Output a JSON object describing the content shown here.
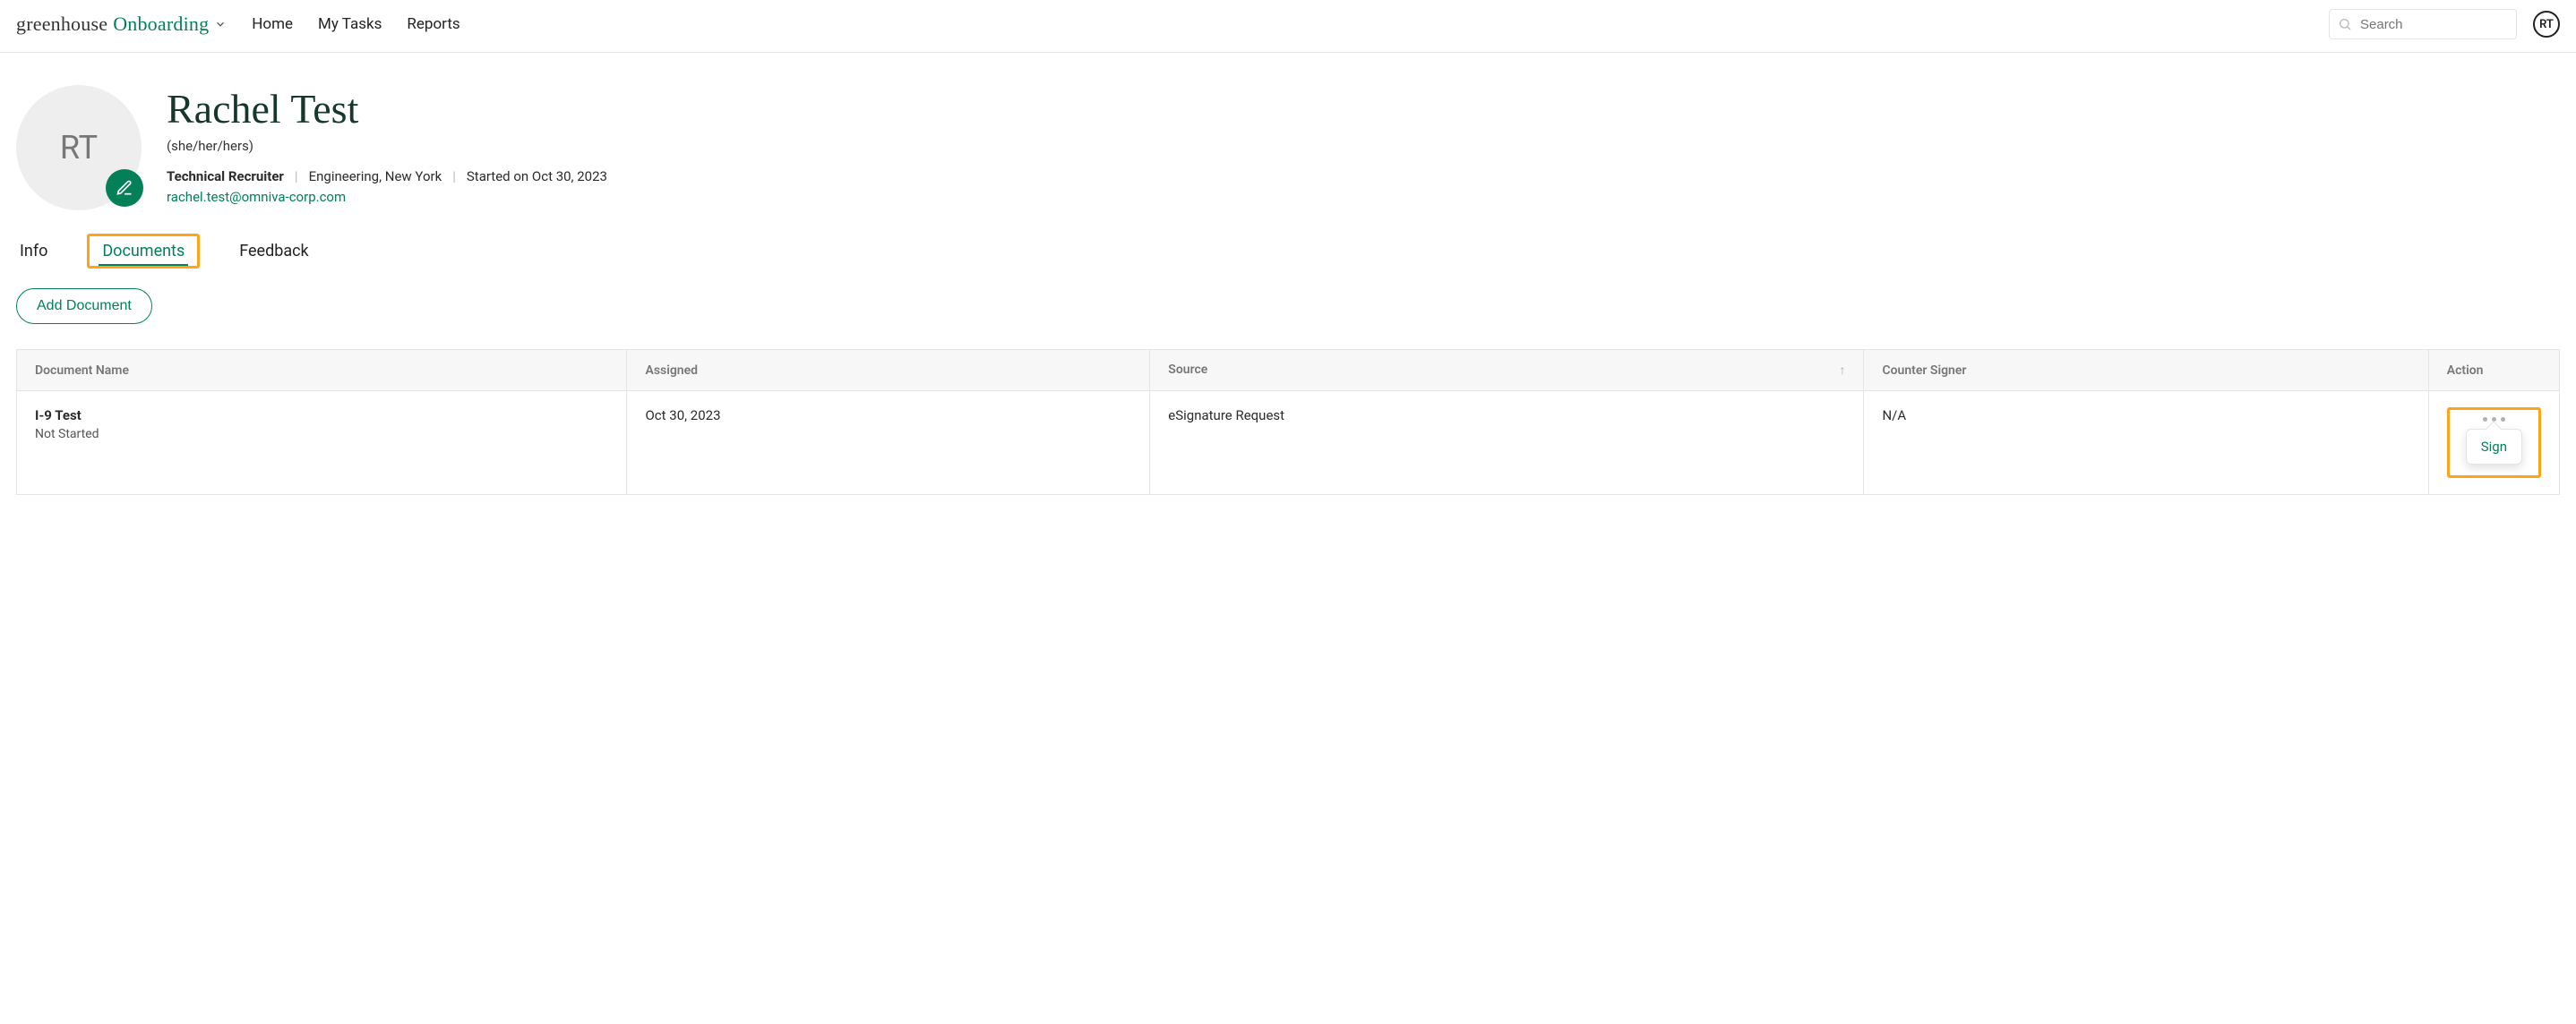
{
  "brand": {
    "first": "greenhouse",
    "second": "Onboarding"
  },
  "nav": {
    "home": "Home",
    "tasks": "My Tasks",
    "reports": "Reports"
  },
  "search": {
    "placeholder": "Search"
  },
  "user_initials": "RT",
  "profile": {
    "avatar_initials": "RT",
    "name": "Rachel Test",
    "pronouns": "(she/her/hers)",
    "role": "Technical Recruiter",
    "dept_location": "Engineering, New York",
    "start": "Started on Oct 30, 2023",
    "email": "rachel.test@omniva-corp.com"
  },
  "tabs": {
    "info": "Info",
    "documents": "Documents",
    "feedback": "Feedback"
  },
  "add_doc_label": "Add Document",
  "table": {
    "headers": {
      "name": "Document Name",
      "assigned": "Assigned",
      "source": "Source",
      "counter": "Counter Signer",
      "action": "Action"
    },
    "rows": [
      {
        "name": "I-9 Test",
        "status": "Not Started",
        "assigned": "Oct 30, 2023",
        "source": "eSignature Request",
        "counter": "N/A"
      }
    ]
  },
  "action_menu": {
    "sign": "Sign"
  }
}
